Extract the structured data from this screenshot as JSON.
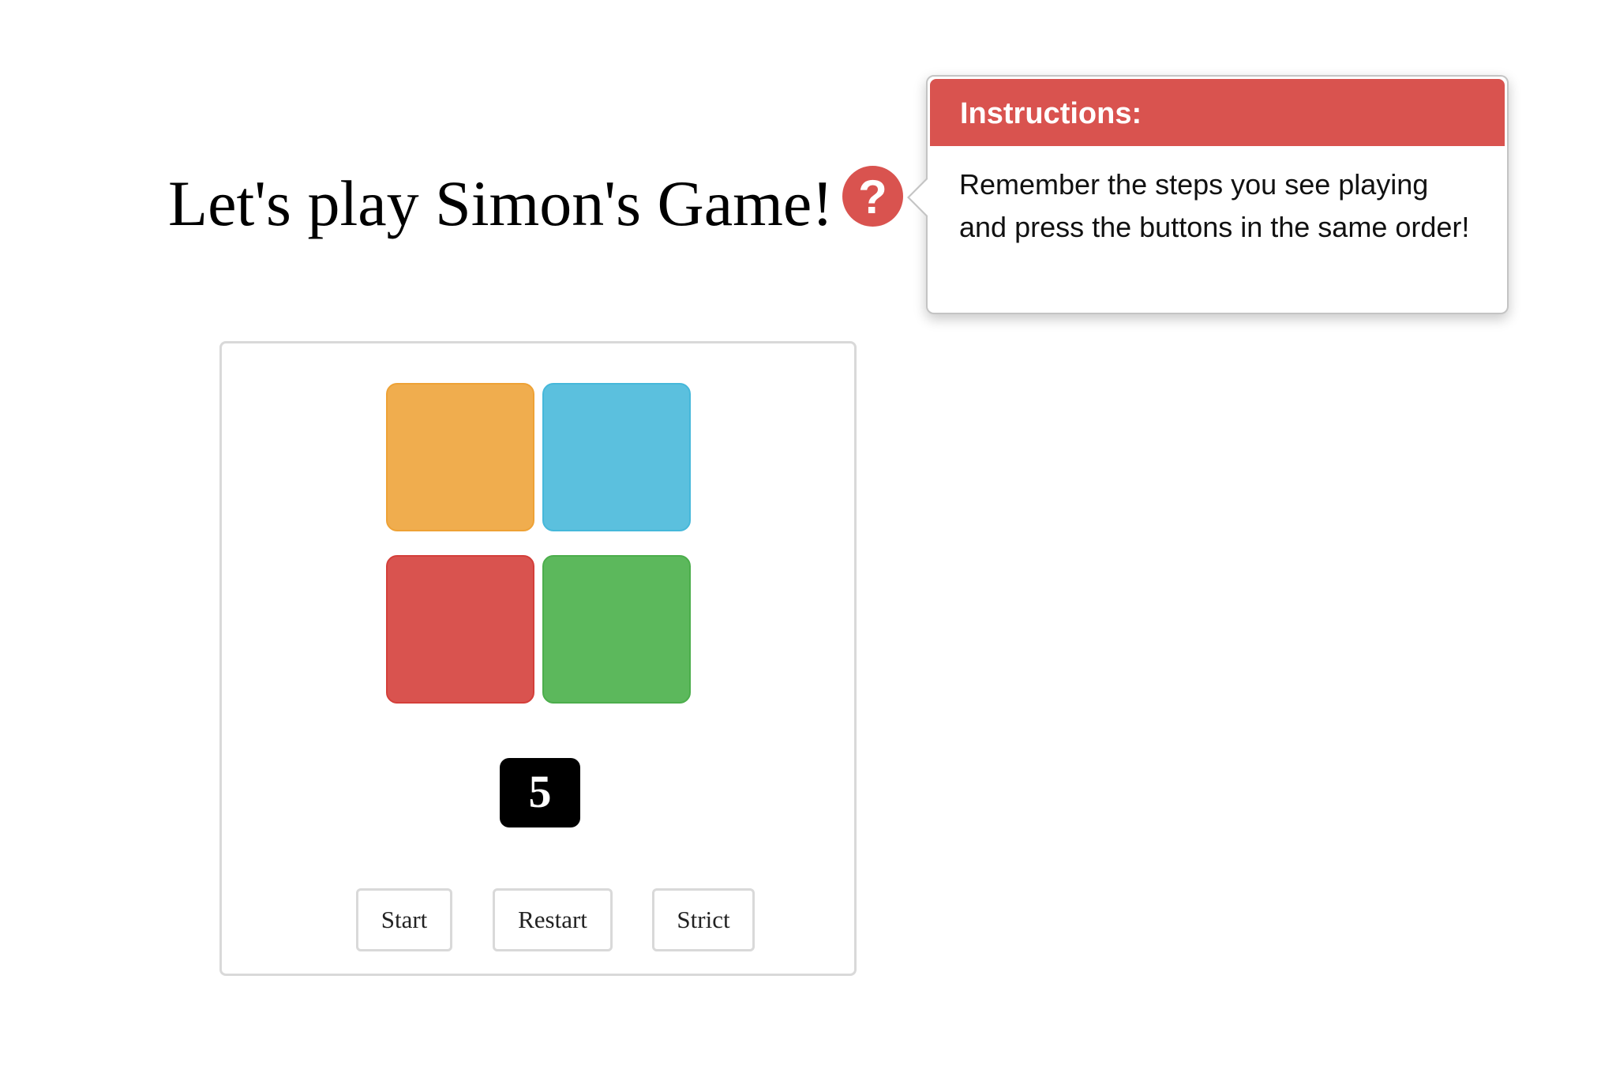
{
  "title": "Let's play Simon's Game!",
  "help": {
    "icon": "question-circle-icon",
    "glyph": "?",
    "color": "#d9534f"
  },
  "instructions": {
    "header": "Instructions:",
    "body": "Remember the steps you see playing and press the buttons in the same order!",
    "header_color": "#d9534f"
  },
  "pads": [
    {
      "name": "orange",
      "color": "#f0ad4e",
      "border": "#eea236"
    },
    {
      "name": "blue",
      "color": "#5bc0de",
      "border": "#46b8da"
    },
    {
      "name": "red",
      "color": "#d9534f",
      "border": "#d43f3a"
    },
    {
      "name": "green",
      "color": "#5cb85c",
      "border": "#4cae4c"
    }
  ],
  "counter": "5",
  "buttons": {
    "start": "Start",
    "restart": "Restart",
    "strict": "Strict"
  }
}
